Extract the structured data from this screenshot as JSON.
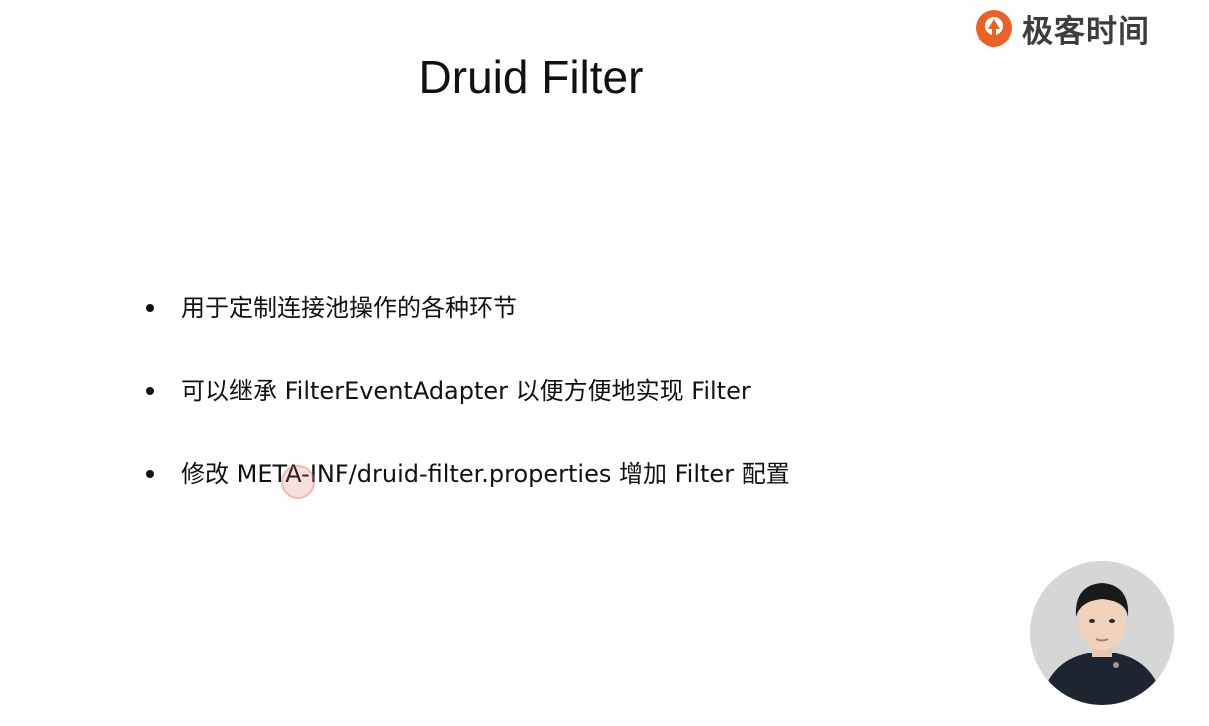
{
  "brand": {
    "logo_text": "极客时间",
    "logo_icon": "geektime-logo-icon",
    "accent_color": "#e8622a"
  },
  "slide": {
    "title": "Druid Filter",
    "bullets": [
      "用于定制连接池操作的各种环节",
      "可以继承 FilterEventAdapter 以便方便地实现 Filter",
      "修改 META-INF/druid-filter.properties 增加 Filter 配置"
    ]
  },
  "overlay": {
    "presenter_video": "presenter-webcam",
    "cursor_indicator": "click-ring"
  }
}
